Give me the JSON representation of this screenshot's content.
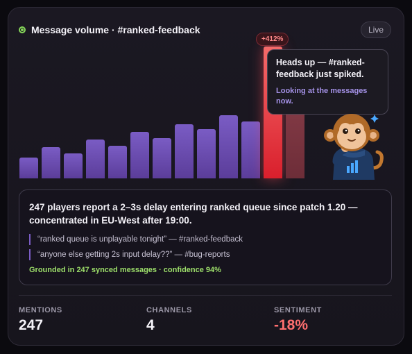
{
  "header": {
    "title": "Message volume · #ranked-feedback",
    "status": "Live"
  },
  "chart_data": {
    "type": "bar",
    "values": [
      30,
      45,
      36,
      56,
      47,
      67,
      58,
      78,
      71,
      91,
      82,
      190,
      140
    ],
    "highlight_index": 11,
    "annotation": "+412%",
    "colors": {
      "normal": "#6a4cb0",
      "spike": "#e53340",
      "after_spike": "#7b3542"
    }
  },
  "tooltip": {
    "message": "Heads up — #ranked-feedback just spiked.",
    "status": "Looking at the messages now."
  },
  "insight": {
    "headline": "247 players report a 2–3s delay entering ranked queue since patch 1.20 — concentrated in EU-West after 19:00.",
    "quotes": [
      "“ranked queue is unplayable tonight” — #ranked-feedback",
      "“anyone else getting 2s input delay??” — #bug-reports"
    ],
    "grounding": "Grounded in 247 synced messages · confidence 94%"
  },
  "stats": [
    {
      "label": "MENTIONS",
      "value": "247"
    },
    {
      "label": "CHANNELS",
      "value": "4"
    },
    {
      "label": "SENTIMENT",
      "value": "-18%"
    }
  ],
  "icons": {
    "live_dot": "status-dot-icon",
    "mascot": "monkey-mascot-icon"
  }
}
